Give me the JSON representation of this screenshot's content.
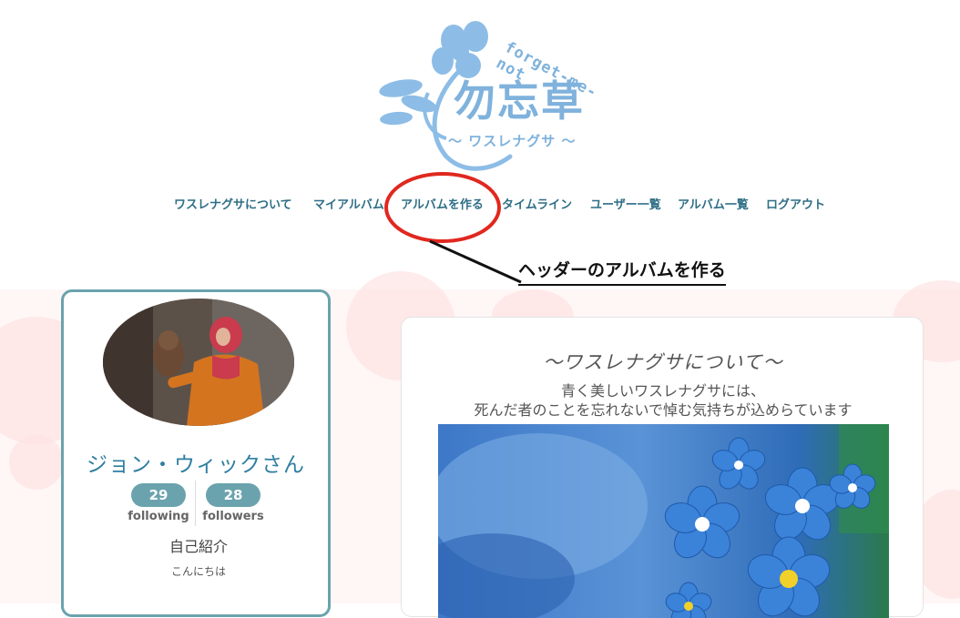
{
  "logo": {
    "kanji": "勿忘草",
    "kana": "〜 ワスレナグサ 〜",
    "english": "forget-me-not"
  },
  "nav": {
    "items": [
      {
        "label": "ワスレナグサについて"
      },
      {
        "label": "マイアルバム"
      },
      {
        "label": "アルバムを作る"
      },
      {
        "label": "タイムライン"
      },
      {
        "label": "ユーザー一覧"
      },
      {
        "label": "アルバム一覧"
      },
      {
        "label": "ログアウト"
      }
    ]
  },
  "annotation": {
    "text": "ヘッダーのアルバムを作る"
  },
  "profile": {
    "name": "ジョン・ウィックさん",
    "following_count": "29",
    "following_label": "following",
    "followers_count": "28",
    "followers_label": "followers",
    "intro_heading": "自己紹介",
    "intro_text": "こんにちは"
  },
  "about": {
    "title": "〜ワスレナグサについて〜",
    "line1": "青く美しいワスレナグサには、",
    "line2": "死んだ者のことを忘れないで悼む気持ちが込めらています"
  },
  "colors": {
    "accent_teal": "#6aa3ad",
    "nav_text": "#2f6e86",
    "logo_blue": "#7fb2dc",
    "annotation_circle": "#e0281f"
  }
}
